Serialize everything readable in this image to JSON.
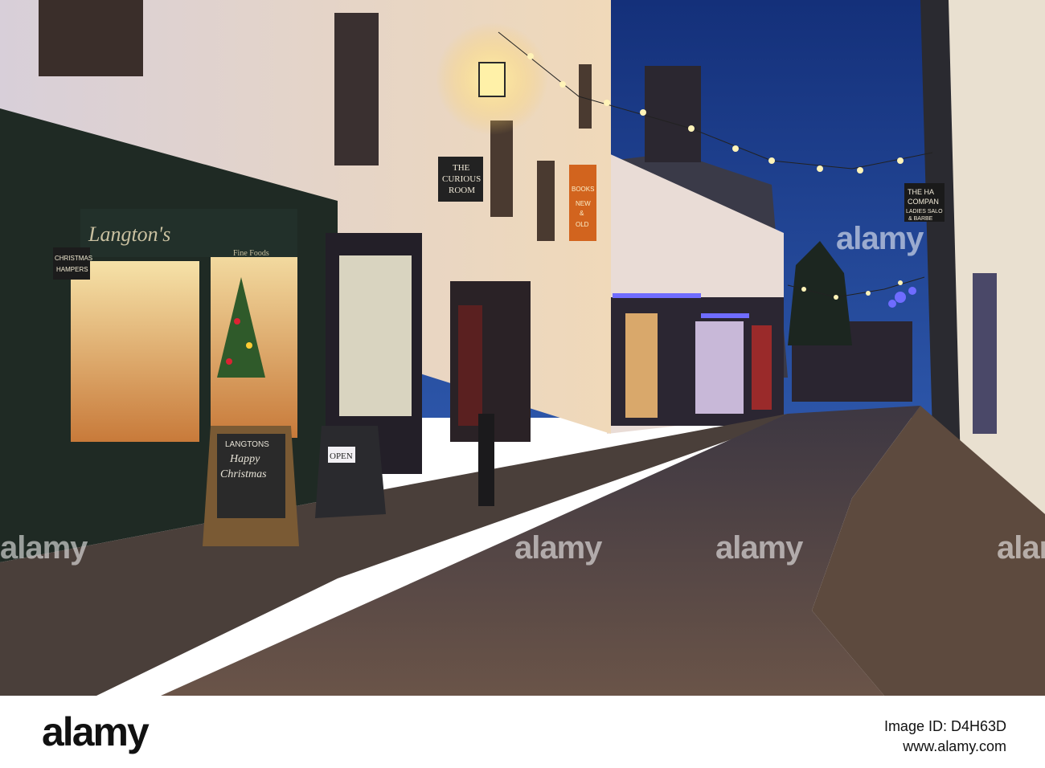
{
  "signs": {
    "curious_room_line1": "THE",
    "curious_room_line2": "CURIOUS",
    "curious_room_line3": "ROOM",
    "books_line1": "BOOKS",
    "books_line2": "NEW",
    "books_line3": "&",
    "books_line4": "OLD",
    "hampers_line1": "CHRISTMAS",
    "hampers_line2": "HAMPERS",
    "shop_name": "Langton's",
    "shop_sub": "Fine Foods",
    "blackboard_line1": "LANGTONS",
    "blackboard_line2": "Happy",
    "blackboard_line3": "Christmas",
    "open_sign": "OPEN",
    "barber_line1": "THE HA",
    "barber_line2": "COMPAN",
    "barber_line3": "LADIES SALO",
    "barber_line4": "& BARBE"
  },
  "watermark": {
    "text": "alamy"
  },
  "footer": {
    "logo": "alamy",
    "stock_label": "Image ID: D4H63D",
    "site": "www.alamy.com"
  },
  "colors": {
    "sky": "#1f3f8a",
    "shopfront": "#1f2a24",
    "cobbles": "#5b4a40"
  }
}
